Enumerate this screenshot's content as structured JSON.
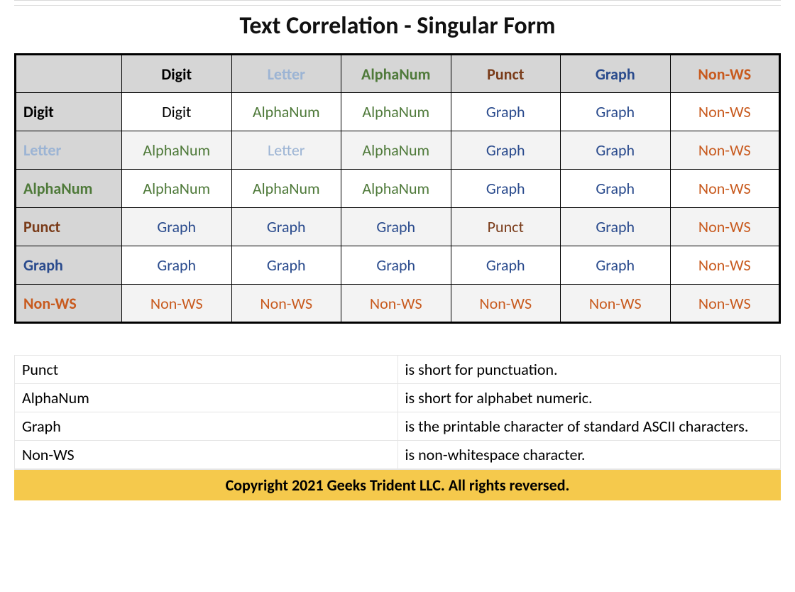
{
  "title": "Text Correlation - Singular Form",
  "categories": [
    {
      "key": "digit",
      "label": "Digit",
      "cls": "c-digit"
    },
    {
      "key": "letter",
      "label": "Letter",
      "cls": "c-letter"
    },
    {
      "key": "alphanum",
      "label": "AlphaNum",
      "cls": "c-alphanum"
    },
    {
      "key": "punct",
      "label": "Punct",
      "cls": "c-punct"
    },
    {
      "key": "graph",
      "label": "Graph",
      "cls": "c-graph"
    },
    {
      "key": "nonws",
      "label": "Non-WS",
      "cls": "c-nonws"
    }
  ],
  "matrix": [
    [
      "digit",
      "alphanum",
      "alphanum",
      "graph",
      "graph",
      "nonws"
    ],
    [
      "alphanum",
      "letter",
      "alphanum",
      "graph",
      "graph",
      "nonws"
    ],
    [
      "alphanum",
      "alphanum",
      "alphanum",
      "graph",
      "graph",
      "nonws"
    ],
    [
      "graph",
      "graph",
      "graph",
      "punct",
      "graph",
      "nonws"
    ],
    [
      "graph",
      "graph",
      "graph",
      "graph",
      "graph",
      "nonws"
    ],
    [
      "nonws",
      "nonws",
      "nonws",
      "nonws",
      "nonws",
      "nonws"
    ]
  ],
  "notes": [
    {
      "term": "Punct",
      "desc": "is short for punctuation."
    },
    {
      "term": "AlphaNum",
      "desc": "is short for alphabet numeric."
    },
    {
      "term": "Graph",
      "desc": "is the printable character of standard ASCII characters."
    },
    {
      "term": "Non-WS",
      "desc": "is non-whitespace character."
    }
  ],
  "copyright": "Copyright 2021 Geeks Trident LLC.  All rights reversed."
}
